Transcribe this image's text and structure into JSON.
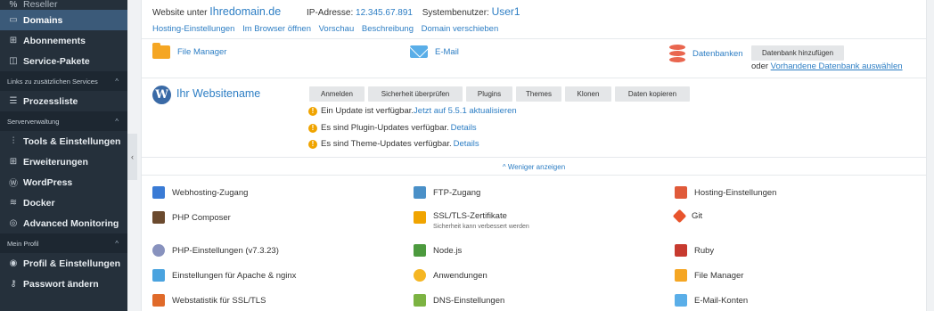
{
  "sidebar": {
    "items": [
      {
        "label": "Reseller"
      },
      {
        "label": "Domains"
      },
      {
        "label": "Abonnements"
      },
      {
        "label": "Service-Pakete"
      },
      {
        "label": "Prozessliste"
      },
      {
        "label": "Tools & Einstellungen"
      },
      {
        "label": "Erweiterungen"
      },
      {
        "label": "WordPress"
      },
      {
        "label": "Docker"
      },
      {
        "label": "Advanced Monitoring"
      },
      {
        "label": "Profil & Einstellungen"
      },
      {
        "label": "Passwort ändern"
      }
    ],
    "sections": [
      {
        "label": "Links zu zusätzlichen Services"
      },
      {
        "label": "Serververwaltung"
      },
      {
        "label": "Mein Profil"
      }
    ],
    "collapse_glyph": "‹"
  },
  "site": {
    "website_label": "Website unter",
    "domain": "Ihredomain.de",
    "ip_label": "IP-Adresse:",
    "ip": "12.345.67.891",
    "user_label": "Systembenutzer:",
    "user": "User1"
  },
  "site_links": [
    "Hosting-Einstellungen",
    "Im Browser öffnen",
    "Vorschau",
    "Beschreibung",
    "Domain verschieben"
  ],
  "features": {
    "file_manager": "File Manager",
    "email": "E-Mail",
    "databases": "Datenbanken",
    "add_db": "Datenbank hinzufügen",
    "or_text": "oder",
    "select_db": "Vorhandene Datenbank auswählen"
  },
  "wordpress": {
    "name": "Ihr Websitename",
    "buttons": [
      "Anmelden",
      "Sicherheit überprüfen",
      "Plugins",
      "Themes",
      "Klonen",
      "Daten kopieren"
    ],
    "notices": [
      {
        "text": "Ein Update ist verfügbar.",
        "link": "Jetzt auf 5.5.1 aktualisieren"
      },
      {
        "text": "Es sind Plugin-Updates verfügbar.",
        "link": "Details"
      },
      {
        "text": "Es sind Theme-Updates verfügbar.",
        "link": "Details"
      }
    ]
  },
  "show_less": "Weniger anzeigen",
  "tools": [
    {
      "label": "Webhosting-Zugang",
      "color": "#3a7bd5"
    },
    {
      "label": "FTP-Zugang",
      "color": "#4a90c8"
    },
    {
      "label": "Hosting-Einstellungen",
      "color": "#e05a3a"
    },
    {
      "label": "PHP Composer",
      "color": "#6b4a2e"
    },
    {
      "label": "SSL/TLS-Zertifikate",
      "sub": "Sicherheit kann verbessert werden",
      "color": "#f0a400"
    },
    {
      "label": "Git",
      "color": "#e8542c"
    },
    {
      "label": "PHP-Einstellungen (v7.3.23)",
      "color": "#8892be"
    },
    {
      "label": "Node.js",
      "color": "#4c9a3e"
    },
    {
      "label": "Ruby",
      "color": "#c73a2f"
    },
    {
      "label": "Einstellungen für Apache & nginx",
      "color": "#4aa3df"
    },
    {
      "label": "Anwendungen",
      "color": "#f5b623"
    },
    {
      "label": "File Manager",
      "color": "#f5a623"
    },
    {
      "label": "Webstatistik für SSL/TLS",
      "color": "#e06a2a"
    },
    {
      "label": "DNS-Einstellungen",
      "color": "#7cb342"
    },
    {
      "label": "E-Mail-Konten",
      "color": "#5aaee8"
    }
  ]
}
